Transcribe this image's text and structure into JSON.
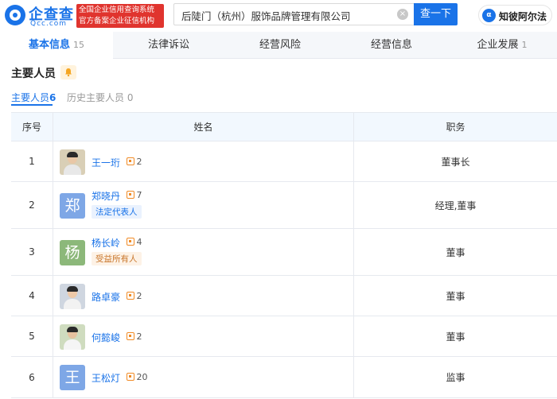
{
  "header": {
    "brand": "企查查",
    "domain": "Qcc.com",
    "badge_line1": "全国企业信用查询系统",
    "badge_line2": "官方备案企业征信机构",
    "search_value": "后陡门（杭州）服饰品牌管理有限公司",
    "search_button": "查一下",
    "law_button": "知彼阿尔法",
    "law_icon_glyph": "α"
  },
  "tabs": [
    {
      "label": "基本信息",
      "count": "15",
      "active": true
    },
    {
      "label": "法律诉讼",
      "count": "",
      "active": false
    },
    {
      "label": "经营风险",
      "count": "",
      "active": false
    },
    {
      "label": "经营信息",
      "count": "",
      "active": false
    },
    {
      "label": "企业发展",
      "count": "1",
      "active": false
    }
  ],
  "section": {
    "title": "主要人员",
    "subtabs": [
      {
        "label": "主要人员",
        "count": "6"
      },
      {
        "label": "历史主要人员",
        "count": "0"
      }
    ]
  },
  "table": {
    "headers": {
      "index": "序号",
      "name": "姓名",
      "role": "职务"
    },
    "rows": [
      {
        "index": "1",
        "name": "王一珩",
        "related": "2",
        "tag": "",
        "role": "董事长",
        "avatar": {
          "type": "photo"
        }
      },
      {
        "index": "2",
        "name": "郑晓丹",
        "related": "7",
        "tag": "法定代表人",
        "role": "经理,董事",
        "avatar": {
          "type": "letter",
          "char": "郑",
          "color": "#7ea7e6"
        }
      },
      {
        "index": "3",
        "name": "杨长岭",
        "related": "4",
        "tag": "受益所有人",
        "role": "董事",
        "avatar": {
          "type": "letter",
          "char": "杨",
          "color": "#8cb87a"
        }
      },
      {
        "index": "4",
        "name": "路卓豪",
        "related": "2",
        "tag": "",
        "role": "董事",
        "avatar": {
          "type": "photo"
        }
      },
      {
        "index": "5",
        "name": "何懿峻",
        "related": "2",
        "tag": "",
        "role": "董事",
        "avatar": {
          "type": "photo"
        }
      },
      {
        "index": "6",
        "name": "王松灯",
        "related": "20",
        "tag": "",
        "role": "监事",
        "avatar": {
          "type": "letter",
          "char": "王",
          "color": "#7ea7e6"
        }
      }
    ]
  },
  "colors": {
    "accent": "#1a73e8",
    "brand_red": "#e0342e",
    "relation_orange": "#f08a24",
    "legal_tag_bg": "#eaf2fe",
    "beneficiary_tag_bg": "#fdf2e6"
  }
}
